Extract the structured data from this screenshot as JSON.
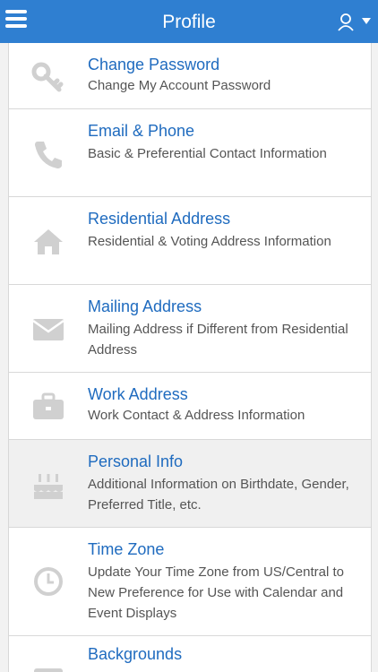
{
  "header": {
    "title": "Profile",
    "menu_icon": "hamburger-menu-icon",
    "user_icon": "user-icon",
    "brand_color": "#2f7fd1"
  },
  "items": [
    {
      "title": "Change Password",
      "desc": "Change My Account Password",
      "icon": "key-icon"
    },
    {
      "title": "Email & Phone",
      "desc": "Basic & Preferential Contact Information",
      "icon": "phone-icon"
    },
    {
      "title": "Residential Address",
      "desc": "Residential & Voting Address Information",
      "icon": "home-icon"
    },
    {
      "title": "Mailing Address",
      "desc": "Mailing Address if Different from Residential Address",
      "icon": "envelope-icon"
    },
    {
      "title": "Work Address",
      "desc": "Work Contact & Address Information",
      "icon": "briefcase-icon"
    },
    {
      "title": "Personal Info",
      "desc": "Additional Information on Birthdate, Gender, Preferred Title, etc.",
      "icon": "cake-icon"
    },
    {
      "title": "Time Zone",
      "desc": "Update Your Time Zone from US/Central to New Preference for Use with Calendar and Event Displays",
      "icon": "clock-icon"
    },
    {
      "title": "Backgrounds",
      "desc": "",
      "icon": "image-icon"
    }
  ]
}
